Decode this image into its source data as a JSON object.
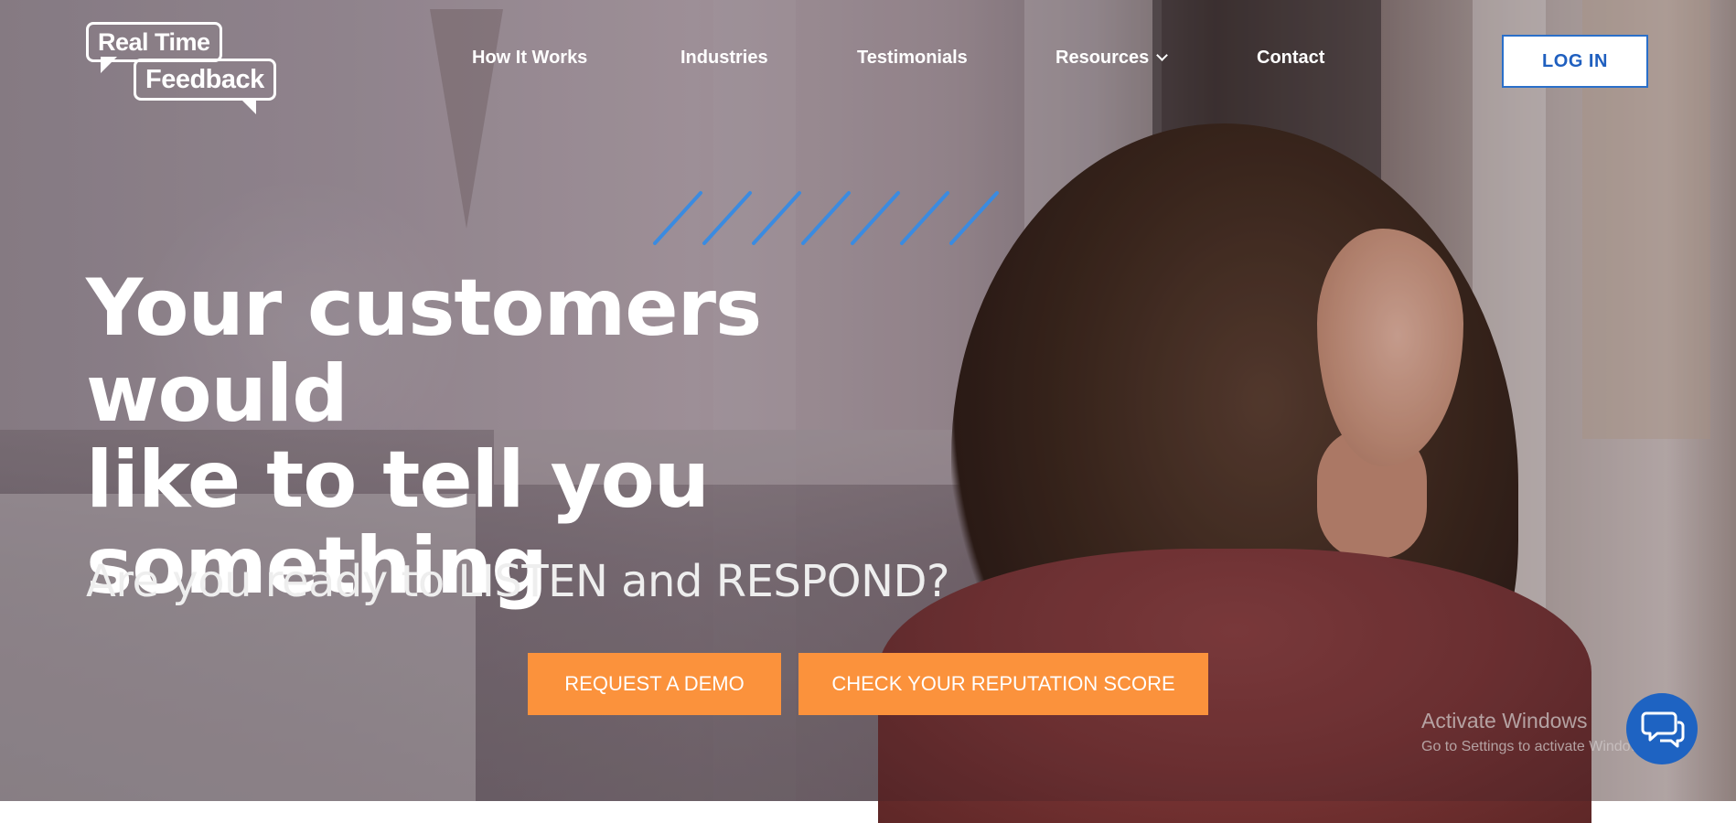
{
  "logo": {
    "line1": "Real Time",
    "line2": "Feedback"
  },
  "nav": {
    "items": [
      {
        "label": "How It Works"
      },
      {
        "label": "Industries"
      },
      {
        "label": "Testimonials"
      },
      {
        "label": "Resources"
      },
      {
        "label": "Contact"
      }
    ],
    "login_label": "LOG IN"
  },
  "hero": {
    "headline_lines": [
      "Your customers would",
      "like to tell you",
      "something"
    ],
    "subheadline": "Are you ready to LISTEN and RESPOND?",
    "cta_demo": "REQUEST A DEMO",
    "cta_reputation": "CHECK YOUR REPUTATION SCORE"
  },
  "watermark": {
    "title": "Activate Windows",
    "subtitle": "Go to Settings to activate Windows."
  },
  "colors": {
    "accent_orange": "#fb923c",
    "login_blue": "#1f5fbf",
    "slash_blue": "#3b8be0",
    "chat_blue": "#1e63c2"
  },
  "icons": {
    "nav_dropdown": "chevron-down-icon",
    "chat": "chat-bubbles-icon"
  }
}
